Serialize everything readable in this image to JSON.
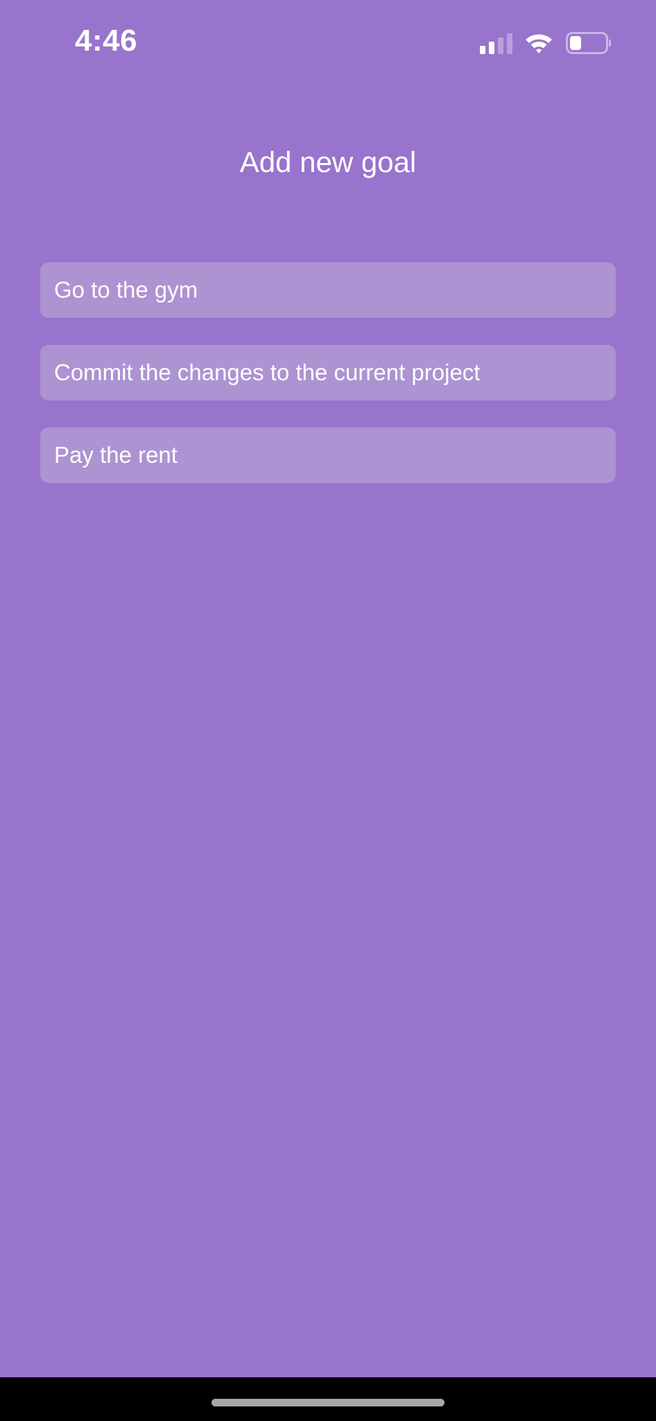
{
  "status_bar": {
    "time": "4:46",
    "signal_icon": "cellular-signal-icon",
    "wifi_icon": "wifi-icon",
    "battery_icon": "battery-icon",
    "battery_level": 0.3
  },
  "header": {
    "title": "Add new goal"
  },
  "goals": [
    {
      "label": "Go to the gym"
    },
    {
      "label": "Commit the changes to the current project"
    },
    {
      "label": "Pay the rent"
    }
  ],
  "colors": {
    "background": "#9874cd",
    "goal_item_background": "#ad93d1",
    "text": "#ffffff",
    "home_bar_area": "#000000",
    "home_indicator": "#a8a8a8"
  }
}
